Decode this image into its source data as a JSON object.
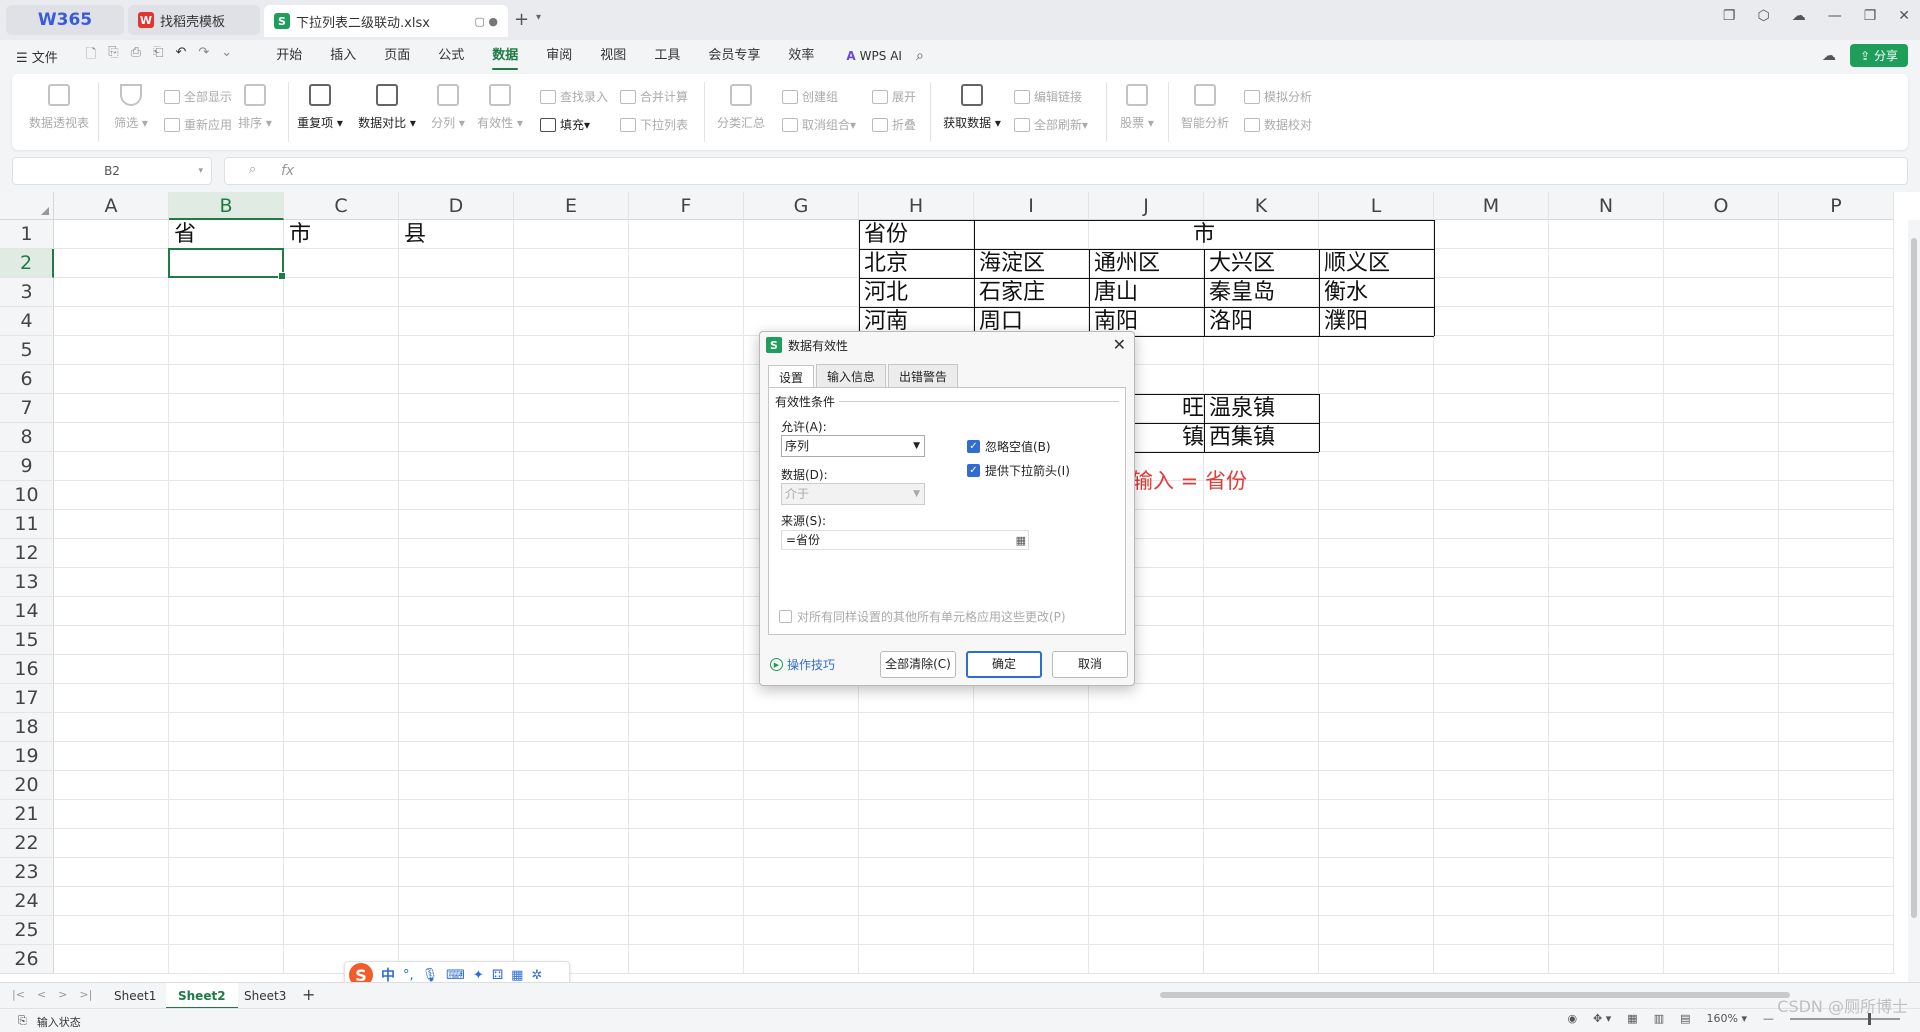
{
  "titlebar": {
    "home_tab": "W365",
    "tabs": [
      {
        "label": "找稻壳模板",
        "icon": "wps-red-icon"
      },
      {
        "label": "下拉列表二级联动.xlsx",
        "icon": "sheet-green-icon"
      }
    ]
  },
  "menubar": {
    "file_label": "文件",
    "items": [
      "开始",
      "插入",
      "页面",
      "公式",
      "数据",
      "审阅",
      "视图",
      "工具",
      "会员专享",
      "效率"
    ],
    "active": "数据",
    "wps_ai": "WPS AI",
    "share": "分享"
  },
  "ribbon": {
    "pivot": "数据透视表",
    "filter": "筛选",
    "show_all": "全部显示",
    "reapply": "重新应用",
    "sort": "排序",
    "dup": "重复项",
    "compare": "数据对比",
    "split": "分列",
    "validity": "有效性",
    "lookup_entry": "查找录入",
    "fill": "填充",
    "merge_calc": "合并计算",
    "dropdown": "下拉列表",
    "subtotal": "分类汇总",
    "group": "创建组",
    "ungroup": "取消组合",
    "expand": "展开",
    "collapse": "折叠",
    "get_data": "获取数据",
    "edit_links": "编辑链接",
    "refresh_all": "全部刷新",
    "stocks": "股票",
    "smart_analysis": "智能分析",
    "what_if": "模拟分析",
    "data_check": "数据校对"
  },
  "formula_bar": {
    "name_box": "B2",
    "fx": "fx",
    "formula": ""
  },
  "sheet": {
    "columns": [
      "A",
      "B",
      "C",
      "D",
      "E",
      "F",
      "G",
      "H",
      "I",
      "J",
      "K",
      "L",
      "M",
      "N",
      "O",
      "P"
    ],
    "selected_column": "B",
    "selected_row": "2",
    "rows": [
      "1",
      "2",
      "3",
      "4",
      "5",
      "6",
      "7",
      "8",
      "9",
      "10",
      "11",
      "12",
      "13",
      "14",
      "15",
      "16",
      "17",
      "18",
      "19",
      "20",
      "21",
      "22",
      "23",
      "24",
      "25",
      "26"
    ],
    "cells": {
      "B1": "省",
      "C1": "市",
      "D1": "县",
      "H1": "省份",
      "I1": "市",
      "H2": "北京",
      "I2": "海淀区",
      "J2": "通州区",
      "K2": "大兴区",
      "L2": "顺义区",
      "H3": "河北",
      "I3": "石家庄",
      "J3": "唐山",
      "K3": "秦皇岛",
      "L3": "衡水",
      "H4": "河南",
      "I4": "周口",
      "J4": "南阳",
      "K4": "洛阳",
      "L4": "濮阳",
      "J7": "旺",
      "K7": "温泉镇",
      "J8": "镇",
      "K8": "西集镇"
    }
  },
  "annotation": "手工输入 = 省份",
  "dialog": {
    "title": "数据有效性",
    "tabs": [
      "设置",
      "输入信息",
      "出错警告"
    ],
    "active_tab": "设置",
    "group_title": "有效性条件",
    "allow_label": "允许(A):",
    "allow_value": "序列",
    "data_label": "数据(D):",
    "data_value": "介于",
    "ignore_blank": "忽略空值(B)",
    "ignore_blank_checked": true,
    "dropdown_arrow": "提供下拉箭头(I)",
    "dropdown_arrow_checked": true,
    "source_label": "来源(S):",
    "source_value": "=省份",
    "apply_all": "对所有同样设置的其他所有单元格应用这些更改(P)",
    "apply_all_checked": false,
    "tips": "操作技巧",
    "clear_all": "全部清除(C)",
    "ok": "确定",
    "cancel": "取消"
  },
  "sheet_tabs": {
    "tabs": [
      "Sheet1",
      "Sheet2",
      "Sheet3"
    ],
    "active": "Sheet2"
  },
  "ime": {
    "mode": "中"
  },
  "statusbar": {
    "status": "输入状态",
    "zoom": "160%"
  },
  "watermark": "CSDN @厕所博士"
}
